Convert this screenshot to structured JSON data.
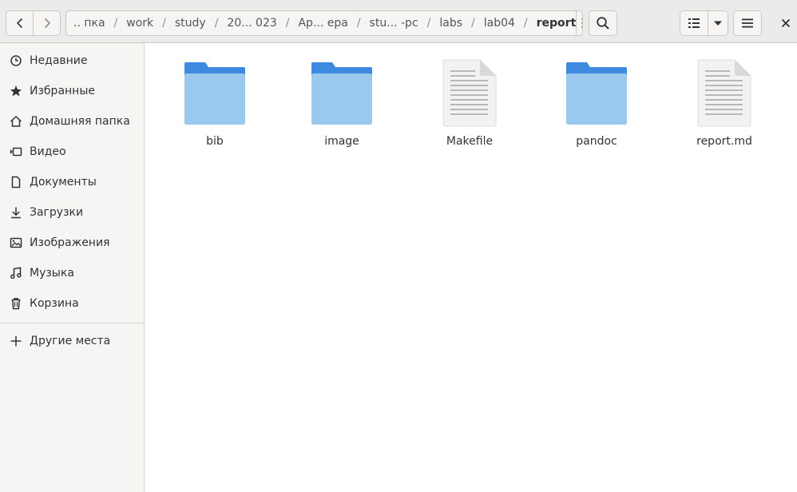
{
  "toolbar": {
    "back_icon": "go-previous-icon",
    "forward_icon": "go-next-icon",
    "menu_icon": "view-more-icon",
    "search_icon": "search-icon",
    "list_view_icon": "view-list-icon",
    "view_options_icon": "pan-down-icon",
    "main_menu_icon": "open-menu-icon",
    "close_icon": "close-icon"
  },
  "breadcrumbs": [
    {
      "label": ".. пка"
    },
    {
      "label": "work"
    },
    {
      "label": "study"
    },
    {
      "label": "20... 023"
    },
    {
      "label": "Ар... ера"
    },
    {
      "label": "stu... -pc"
    },
    {
      "label": "labs"
    },
    {
      "label": "lab04"
    },
    {
      "label": "report"
    }
  ],
  "sidebar": {
    "items": [
      {
        "label": "Недавние",
        "icon": "clock-icon"
      },
      {
        "label": "Избранные",
        "icon": "star-icon"
      },
      {
        "label": "Домашняя папка",
        "icon": "home-icon"
      },
      {
        "label": "Видео",
        "icon": "video-icon"
      },
      {
        "label": "Документы",
        "icon": "document-icon"
      },
      {
        "label": "Загрузки",
        "icon": "download-icon"
      },
      {
        "label": "Изображения",
        "icon": "image-icon"
      },
      {
        "label": "Музыка",
        "icon": "music-icon"
      },
      {
        "label": "Корзина",
        "icon": "trash-icon"
      }
    ],
    "other_places": {
      "label": "Другие места",
      "icon": "plus-icon"
    }
  },
  "files": [
    {
      "name": "bib",
      "type": "folder"
    },
    {
      "name": "image",
      "type": "folder"
    },
    {
      "name": "Makefile",
      "type": "text"
    },
    {
      "name": "pandoc",
      "type": "folder"
    },
    {
      "name": "report.md",
      "type": "text"
    }
  ],
  "colors": {
    "folder_top": "#3d8ae0",
    "folder_front": "#a8d3ea",
    "headerbar": "#ebebeb",
    "sidebar": "#f6f5f4"
  }
}
